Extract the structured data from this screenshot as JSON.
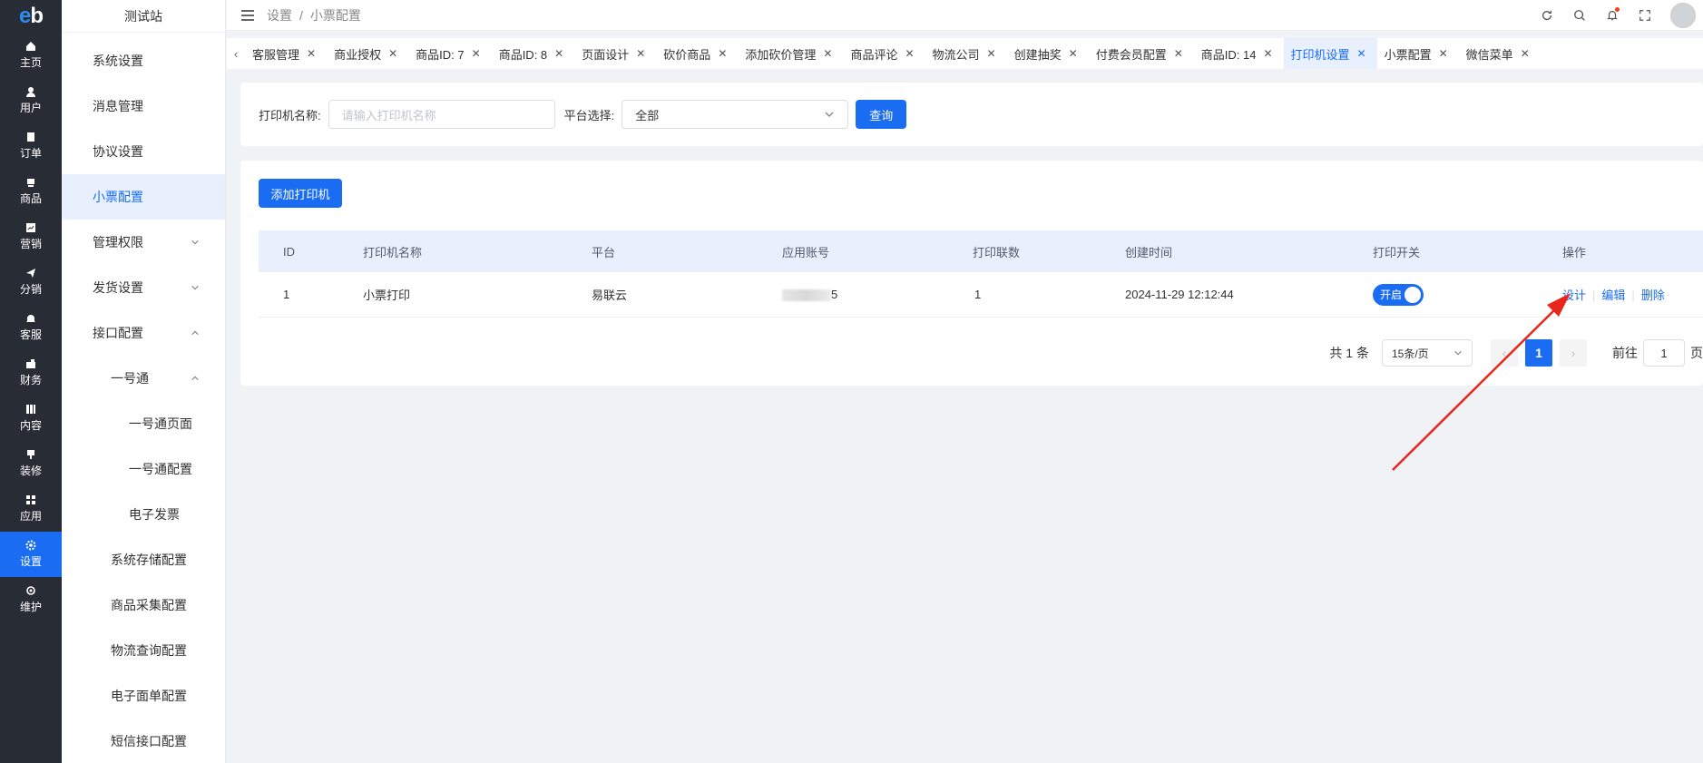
{
  "logo": {
    "e": "e",
    "b": "b"
  },
  "rail": [
    {
      "label": "主页",
      "icon": "home-icon"
    },
    {
      "label": "用户",
      "icon": "user-icon"
    },
    {
      "label": "订单",
      "icon": "order-icon"
    },
    {
      "label": "商品",
      "icon": "product-icon"
    },
    {
      "label": "营销",
      "icon": "marketing-icon"
    },
    {
      "label": "分销",
      "icon": "send-icon"
    },
    {
      "label": "客服",
      "icon": "bell-icon"
    },
    {
      "label": "财务",
      "icon": "finance-icon"
    },
    {
      "label": "内容",
      "icon": "content-icon"
    },
    {
      "label": "装修",
      "icon": "brush-icon"
    },
    {
      "label": "应用",
      "icon": "apps-icon"
    },
    {
      "label": "设置",
      "icon": "gear-icon",
      "active": true
    },
    {
      "label": "维护",
      "icon": "maintain-icon"
    }
  ],
  "site_name": "测试站",
  "submenu": [
    {
      "label": "系统设置",
      "level": 1
    },
    {
      "label": "消息管理",
      "level": 1
    },
    {
      "label": "协议设置",
      "level": 1
    },
    {
      "label": "小票配置",
      "level": 1,
      "active": true
    },
    {
      "label": "管理权限",
      "level": 1,
      "chevron": "down"
    },
    {
      "label": "发货设置",
      "level": 1,
      "chevron": "down"
    },
    {
      "label": "接口配置",
      "level": 1,
      "chevron": "up"
    },
    {
      "label": "一号通",
      "level": 2,
      "chevron": "up"
    },
    {
      "label": "一号通页面",
      "level": 3
    },
    {
      "label": "一号通配置",
      "level": 3
    },
    {
      "label": "电子发票",
      "level": 3
    },
    {
      "label": "系统存储配置",
      "level": 2
    },
    {
      "label": "商品采集配置",
      "level": 2
    },
    {
      "label": "物流查询配置",
      "level": 2
    },
    {
      "label": "电子面单配置",
      "level": 2
    },
    {
      "label": "短信接口配置",
      "level": 2
    }
  ],
  "breadcrumb": {
    "root": "设置",
    "separator": "/",
    "current": "小票配置"
  },
  "tabs": [
    {
      "label": "客服管理"
    },
    {
      "label": "商业授权"
    },
    {
      "label": "商品ID: 7"
    },
    {
      "label": "商品ID: 8"
    },
    {
      "label": "页面设计"
    },
    {
      "label": "砍价商品"
    },
    {
      "label": "添加砍价管理"
    },
    {
      "label": "商品评论"
    },
    {
      "label": "物流公司"
    },
    {
      "label": "创建抽奖"
    },
    {
      "label": "付费会员配置"
    },
    {
      "label": "商品ID: 14"
    },
    {
      "label": "打印机设置",
      "active": true
    },
    {
      "label": "小票配置"
    },
    {
      "label": "微信菜单"
    }
  ],
  "search": {
    "printer_name_label": "打印机名称:",
    "printer_name_placeholder": "请输入打印机名称",
    "platform_label": "平台选择:",
    "platform_value": "全部",
    "query_button": "查询"
  },
  "add_button": "添加打印机",
  "table": {
    "headers": [
      "ID",
      "打印机名称",
      "平台",
      "应用账号",
      "打印联数",
      "创建时间",
      "打印开关",
      "操作"
    ],
    "rows": [
      {
        "id": "1",
        "name": "小票打印",
        "platform": "易联云",
        "account_suffix": "5",
        "copies": "1",
        "created": "2024-11-29 12:12:44",
        "switch_label": "开启",
        "actions": [
          "设计",
          "编辑",
          "删除"
        ]
      }
    ]
  },
  "pagination": {
    "total": "共 1 条",
    "page_size": "15条/页",
    "current": "1",
    "goto_label": "前往",
    "goto_value": "1",
    "page_unit": "页"
  },
  "colors": {
    "primary": "#1a6cf3",
    "rail_bg": "#282c34",
    "annotation_arrow": "#e8261b"
  }
}
